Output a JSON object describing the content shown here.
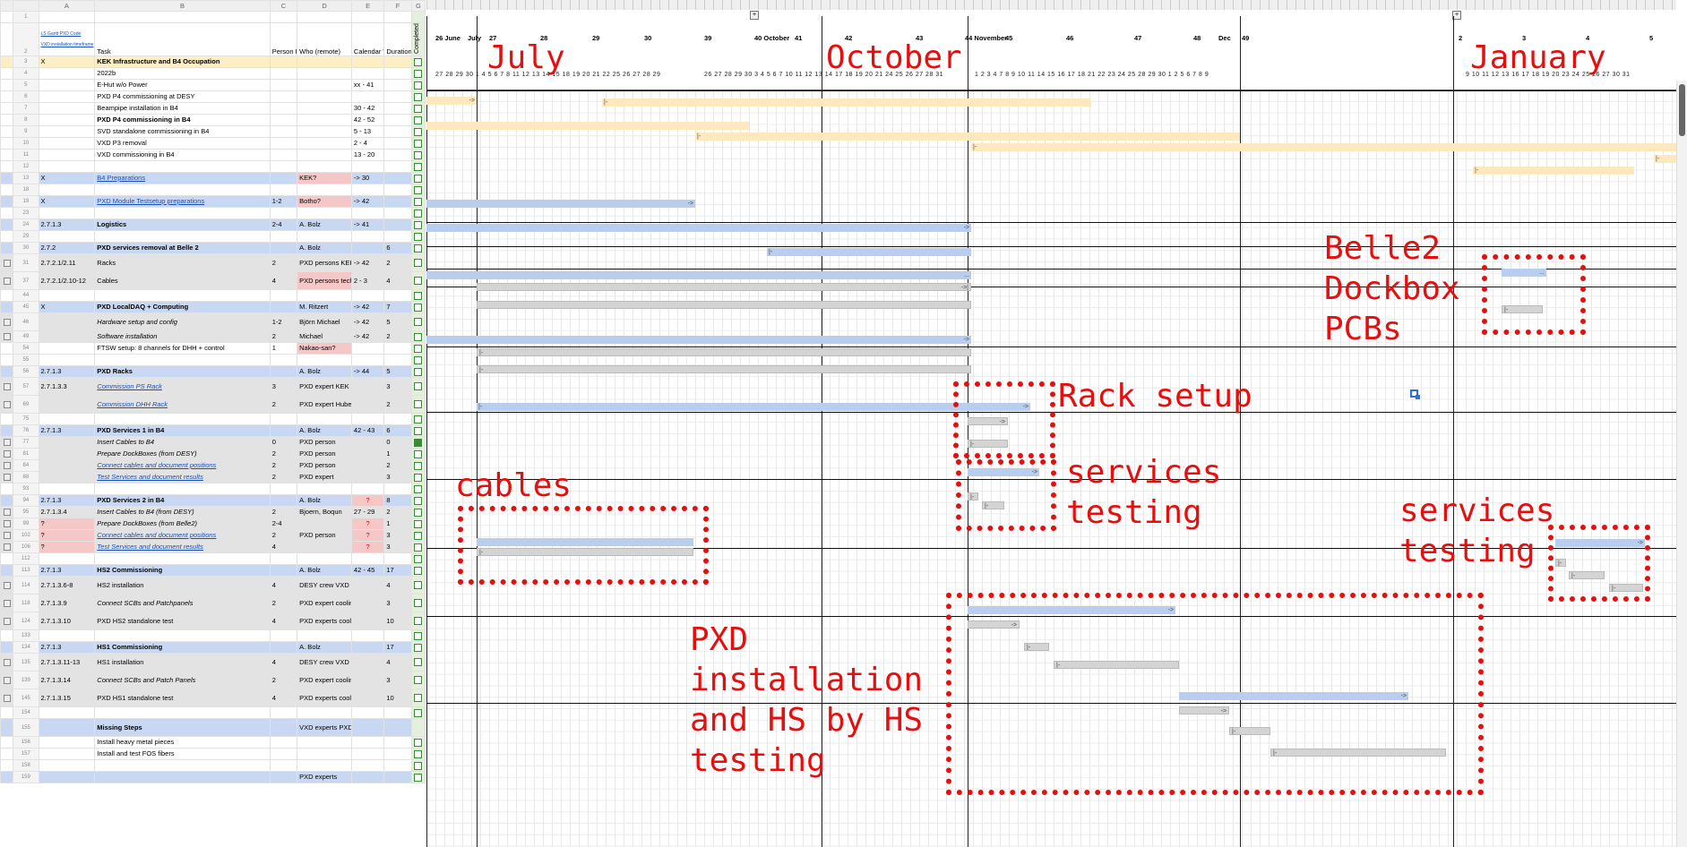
{
  "sheet": {
    "col_headers": [
      "A",
      "B",
      "C",
      "D",
      "E",
      "F",
      "G"
    ],
    "head": {
      "link1": "LS Gantt PXD Code",
      "link2": "VXD installation timeframe",
      "task": "Task",
      "person_power": "Person Power",
      "who": "Who (remote)",
      "week": "Calendar Week",
      "duration": "Duration / Days",
      "completed": "Completed"
    },
    "rows": [
      {
        "n": "3",
        "a": "X",
        "b": "KEK Infrastructure and B4 Occupation",
        "c": "",
        "d": "",
        "e": "",
        "f": "",
        "style": "yellow",
        "bold": true
      },
      {
        "n": "4",
        "a": "",
        "b": "2022b",
        "c": "",
        "d": "",
        "e": "",
        "f": ""
      },
      {
        "n": "5",
        "a": "",
        "b": "E-Hut w/o Power",
        "c": "",
        "d": "",
        "e": "xx - 41",
        "f": ""
      },
      {
        "n": "6",
        "a": "",
        "b": "PXD P4 commissioning at DESY",
        "c": "",
        "d": "",
        "e": "",
        "f": ""
      },
      {
        "n": "7",
        "a": "",
        "b": "Beampipe installation in B4",
        "c": "",
        "d": "",
        "e": "30 - 42",
        "f": ""
      },
      {
        "n": "8",
        "a": "",
        "b": "PXD P4 commissioning in B4",
        "c": "",
        "d": "",
        "e": "42 - 52",
        "f": "",
        "bold": true
      },
      {
        "n": "9",
        "a": "",
        "b": "SVD standalone commissioning in B4",
        "c": "",
        "d": "",
        "e": "5 - 13",
        "f": ""
      },
      {
        "n": "10",
        "a": "",
        "b": "VXD P3 removal",
        "c": "",
        "d": "",
        "e": "2 - 4",
        "f": ""
      },
      {
        "n": "11",
        "a": "",
        "b": "VXD commissioning in B4",
        "c": "",
        "d": "",
        "e": "13 - 20",
        "f": ""
      },
      {
        "n": "12",
        "a": "",
        "b": "",
        "c": "",
        "d": "",
        "e": "",
        "f": ""
      },
      {
        "n": "13",
        "a": "X",
        "b": "B4 Preparations",
        "c": "",
        "d": "KEK?",
        "e": "-> 30",
        "f": "",
        "style": "blue",
        "link": true,
        "pinkD": true
      },
      {
        "n": "18",
        "a": "",
        "b": "",
        "c": "",
        "d": "",
        "e": "",
        "f": ""
      },
      {
        "n": "19",
        "a": "X",
        "b": "PXD Module Testsetup preparations",
        "c": "1-2",
        "d": "Botho?",
        "e": "-> 42",
        "f": "",
        "style": "blue",
        "link": true,
        "pinkD": true
      },
      {
        "n": "23",
        "a": "",
        "b": "",
        "c": "",
        "d": "",
        "e": "",
        "f": ""
      },
      {
        "n": "24",
        "a": "2.7.1.3",
        "b": "Logistics",
        "c": "2-4",
        "d": "A. Bolz",
        "e": "-> 41",
        "f": "",
        "style": "blue",
        "bold": true
      },
      {
        "n": "29",
        "a": "",
        "b": "",
        "c": "",
        "d": "",
        "e": "",
        "f": ""
      },
      {
        "n": "30",
        "a": "2.7.2",
        "b": "PXD services removal at Belle 2",
        "c": "",
        "d": "A. Bolz",
        "e": "",
        "f": "6",
        "style": "blue",
        "bold": true
      },
      {
        "n": "31",
        "a": "2.7.2.1/2.11",
        "b": "Racks",
        "c": "2",
        "d": "PXD persons KEK crane",
        "e": "-> 42",
        "f": "2",
        "style": "grey",
        "tall": true,
        "grp": true
      },
      {
        "n": "37",
        "a": "2.7.2.1/2.10-12",
        "b": "Cables",
        "c": "4",
        "d": "PXD persons technicians?",
        "e": "2 - 3",
        "f": "4",
        "style": "grey",
        "tall": true,
        "grp": true,
        "pinkD": true
      },
      {
        "n": "44",
        "a": "",
        "b": "",
        "c": "",
        "d": "",
        "e": "",
        "f": ""
      },
      {
        "n": "45",
        "a": "X",
        "b": "PXD LocalDAQ + Computing",
        "c": "",
        "d": "M. Ritzert",
        "e": "-> 42",
        "f": "7",
        "style": "blue",
        "bold": true
      },
      {
        "n": "46",
        "a": "",
        "b": "Hardware setup and config",
        "c": "1-2",
        "d": "Björn Michael",
        "e": "-> 42",
        "f": "5",
        "style": "grey",
        "tall": true,
        "ital": true,
        "grp": true
      },
      {
        "n": "49",
        "a": "",
        "b": "Software installation",
        "c": "2",
        "d": "Michael",
        "e": "-> 42",
        "f": "2",
        "style": "grey",
        "ital": true,
        "grp": true
      },
      {
        "n": "54",
        "a": "",
        "b": "FTSW setup: 8 channels for DHH + control",
        "c": "1",
        "d": "Nakao-san?",
        "e": "",
        "f": "",
        "pinkD": true
      },
      {
        "n": "55",
        "a": "",
        "b": "",
        "c": "",
        "d": "",
        "e": "",
        "f": ""
      },
      {
        "n": "56",
        "a": "2.7.1.3",
        "b": "PXD Racks",
        "c": "",
        "d": "A. Bolz",
        "e": "-> 44",
        "f": "5",
        "style": "blue",
        "bold": true
      },
      {
        "n": "57",
        "a": "2.7.1.3.3",
        "b": "Commission PS Rack",
        "c": "3",
        "d": "PXD expert KEK crane",
        "e": "",
        "f": "3",
        "style": "grey",
        "tall": true,
        "link": true,
        "ital": true,
        "grp": true
      },
      {
        "n": "69",
        "a": "",
        "b": "Commission DHH Rack",
        "c": "2",
        "d": "PXD expert Huber (r)",
        "e": "",
        "f": "2",
        "style": "grey",
        "tall": true,
        "link": true,
        "ital": true,
        "grp": true
      },
      {
        "n": "75",
        "a": "",
        "b": "",
        "c": "",
        "d": "",
        "e": "",
        "f": ""
      },
      {
        "n": "76",
        "a": "2.7.1.3",
        "b": "PXD Services 1 in B4",
        "c": "",
        "d": "A. Bolz",
        "e": "42 - 43",
        "f": "6",
        "style": "blue",
        "bold": true
      },
      {
        "n": "77",
        "a": "",
        "b": "Insert Cables to B4",
        "c": "0",
        "d": "PXD person",
        "e": "",
        "f": "0",
        "style": "grey",
        "ital": true,
        "grp": true,
        "checked": true
      },
      {
        "n": "81",
        "a": "",
        "b": "Prepare DockBoxes (from DESY)",
        "c": "2",
        "d": "PXD person",
        "e": "",
        "f": "1",
        "style": "grey",
        "ital": true,
        "grp": true
      },
      {
        "n": "84",
        "a": "",
        "b": "Connect cables and document positions",
        "c": "2",
        "d": "PXD person",
        "e": "",
        "f": "2",
        "style": "grey",
        "ital": true,
        "link": true,
        "grp": true
      },
      {
        "n": "88",
        "a": "",
        "b": "Test Services and document results",
        "c": "2",
        "d": "PXD expert",
        "e": "",
        "f": "3",
        "style": "grey",
        "ital": true,
        "link": true,
        "grp": true
      },
      {
        "n": "93",
        "a": "",
        "b": "",
        "c": "",
        "d": "",
        "e": "",
        "f": ""
      },
      {
        "n": "94",
        "a": "2.7.1.3",
        "b": "PXD Services 2 in B4",
        "c": "",
        "d": "A. Bolz",
        "e": "?",
        "f": "8",
        "style": "blue",
        "bold": true,
        "pinkE": true
      },
      {
        "n": "95",
        "a": "2.7.1.3.4",
        "b": "Insert Cables to B4 (from DESY)",
        "c": "2",
        "d": "Bjoern, Boqun",
        "e": "27 - 29",
        "f": "2",
        "style": "grey",
        "ital": true,
        "grp": true
      },
      {
        "n": "99",
        "a": "?",
        "b": "Prepare DockBoxes (from Belle2)",
        "c": "2-4",
        "d": "",
        "e": "?",
        "f": "1",
        "style": "grey",
        "ital": true,
        "grp": true,
        "pinkA": true,
        "pinkE": true
      },
      {
        "n": "102",
        "a": "?",
        "b": "Connect cables and document positions",
        "c": "2",
        "d": "PXD person",
        "e": "?",
        "f": "3",
        "style": "grey",
        "ital": true,
        "link": true,
        "grp": true,
        "pinkA": true,
        "pinkE": true
      },
      {
        "n": "106",
        "a": "?",
        "b": "Test Services and document results",
        "c": "4",
        "d": "",
        "e": "?",
        "f": "3",
        "style": "grey",
        "ital": true,
        "link": true,
        "grp": true,
        "pinkA": true,
        "pinkE": true
      },
      {
        "n": "112",
        "a": "",
        "b": "",
        "c": "",
        "d": "",
        "e": "",
        "f": ""
      },
      {
        "n": "113",
        "a": "2.7.1.3",
        "b": "HS2 Commissioning",
        "c": "",
        "d": "A. Bolz",
        "e": "42 - 45",
        "f": "17",
        "style": "blue",
        "bold": true
      },
      {
        "n": "114",
        "a": "2.7.1.3.6-8",
        "b": "HS2 installation",
        "c": "4",
        "d": "DESY crew VXD expert",
        "e": "",
        "f": "4",
        "style": "grey",
        "tall": true,
        "grp": true
      },
      {
        "n": "118",
        "a": "2.7.1.3.9",
        "b": "Connect SCBs and Patchpanels",
        "c": "2",
        "d": "PXD expert cooling expert",
        "e": "",
        "f": "3",
        "style": "grey",
        "tall": true,
        "ital": true,
        "grp": true
      },
      {
        "n": "124",
        "a": "2.7.1.3.10",
        "b": "PXD HS2 standalone test",
        "c": "4",
        "d": "PXD experts cooling expert",
        "e": "",
        "f": "10",
        "style": "grey",
        "tall": true,
        "grp": true
      },
      {
        "n": "133",
        "a": "",
        "b": "",
        "c": "",
        "d": "",
        "e": "",
        "f": ""
      },
      {
        "n": "134",
        "a": "2.7.1.3",
        "b": "HS1 Commissioning",
        "c": "",
        "d": "A. Bolz",
        "e": "",
        "f": "17",
        "style": "blue",
        "bold": true
      },
      {
        "n": "135",
        "a": "2.7.1.3.11-13",
        "b": "HS1 installation",
        "c": "4",
        "d": "DESY crew VXD expert",
        "e": "",
        "f": "4",
        "style": "grey",
        "tall": true,
        "grp": true
      },
      {
        "n": "139",
        "a": "2.7.1.3.14",
        "b": "Connect SCBs and Patch Panels",
        "c": "2",
        "d": "PXD expert cooling expert",
        "e": "",
        "f": "3",
        "style": "grey",
        "tall": true,
        "ital": true,
        "grp": true
      },
      {
        "n": "145",
        "a": "2.7.1.3.15",
        "b": "PXD HS1 standalone test",
        "c": "4",
        "d": "PXD experts cooling expert",
        "e": "",
        "f": "10",
        "style": "grey",
        "tall": true,
        "grp": true
      },
      {
        "n": "154",
        "a": "",
        "b": "",
        "c": "",
        "d": "",
        "e": "",
        "f": ""
      },
      {
        "n": "155",
        "a": "",
        "b": "Missing Steps",
        "c": "",
        "d": "VXD experts PXD experts",
        "e": "",
        "f": "",
        "style": "blue",
        "bold": true,
        "tall": true,
        "nobox": true
      },
      {
        "n": "156",
        "a": "",
        "b": "Install heavy metal pieces",
        "c": "",
        "d": "",
        "e": "",
        "f": ""
      },
      {
        "n": "157",
        "a": "",
        "b": "Install and test FOS fibers",
        "c": "",
        "d": "",
        "e": "",
        "f": ""
      },
      {
        "n": "158",
        "a": "",
        "b": "",
        "c": "",
        "d": "",
        "e": "",
        "f": ""
      },
      {
        "n": "159",
        "a": "",
        "b": "",
        "c": "",
        "d": "PXD experts",
        "e": "",
        "f": "",
        "style": "blue"
      }
    ]
  },
  "gantt": {
    "week_labels": [
      {
        "text": "26 June"
      },
      {
        "text": "July"
      },
      {
        "text": "27"
      },
      {
        "text": "28"
      },
      {
        "text": "29"
      },
      {
        "text": "30"
      },
      {
        "text": "39"
      },
      {
        "text": "40 October"
      },
      {
        "text": "41"
      },
      {
        "text": "42"
      },
      {
        "text": "43"
      },
      {
        "text": "44 November"
      },
      {
        "text": "45"
      },
      {
        "text": "46"
      },
      {
        "text": "47"
      },
      {
        "text": "48"
      },
      {
        "text": "Dec"
      },
      {
        "text": "49"
      },
      {
        "text": "2"
      },
      {
        "text": "3"
      },
      {
        "text": "4"
      },
      {
        "text": "5"
      }
    ],
    "day_runs": [
      "27 28 29 30  1    4  5  6  7  8    11 12 13 14 15    18 19 20 21 22    25 26 27 28 29",
      "26 27 28 29 30   3  4  5  6  7    10 11 12 13 14    17 18   19 20 21    24 25 26 27 28   31",
      "1  2  3  4    7  8  9 10 11    14 15 16 17 18    21 22 23 24 25    28 29 30  1  2    5  6  7  8  9",
      "9 10 11 12 13    16 17 18 19 20    23 24 25 26 27    30 31"
    ],
    "months": [
      "July",
      "October",
      "January"
    ],
    "bar_labels": {
      "start": "|-",
      "end": "->",
      "dots": "...",
      "endbar": "->|"
    }
  },
  "annotations": {
    "belle2": "Belle2\nDockbox\nPCBs",
    "rack_setup": "Rack setup",
    "services_testing_1": "services\ntesting",
    "cables": "cables",
    "services_testing_2": "services\ntesting",
    "pxd_install": "PXD\ninstallation\nand HS by HS\ntesting"
  },
  "colors": {
    "annotation": "#e41010",
    "blue_row": "#c9d8f2",
    "yellow_row": "#fdeec4",
    "grey_row": "#e3e3e3",
    "pink_cell": "#f5c7c7"
  }
}
